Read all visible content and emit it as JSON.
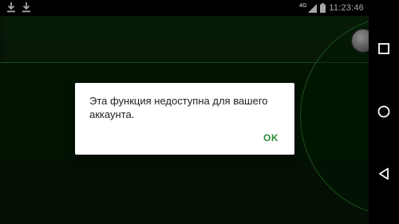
{
  "status_bar": {
    "time": "11:23:46",
    "network_type": "4G",
    "icons": [
      "download-icon",
      "download-icon",
      "network-signal-icon",
      "battery-icon"
    ]
  },
  "dialog": {
    "message": "Эта функция недоступна для вашего аккаунта.",
    "ok_label": "OK"
  },
  "nav_bar": {
    "buttons": [
      "recents-icon",
      "home-icon",
      "back-icon"
    ]
  },
  "colors": {
    "accent": "#2e8b3a",
    "app_background": "#0a1f0a"
  }
}
